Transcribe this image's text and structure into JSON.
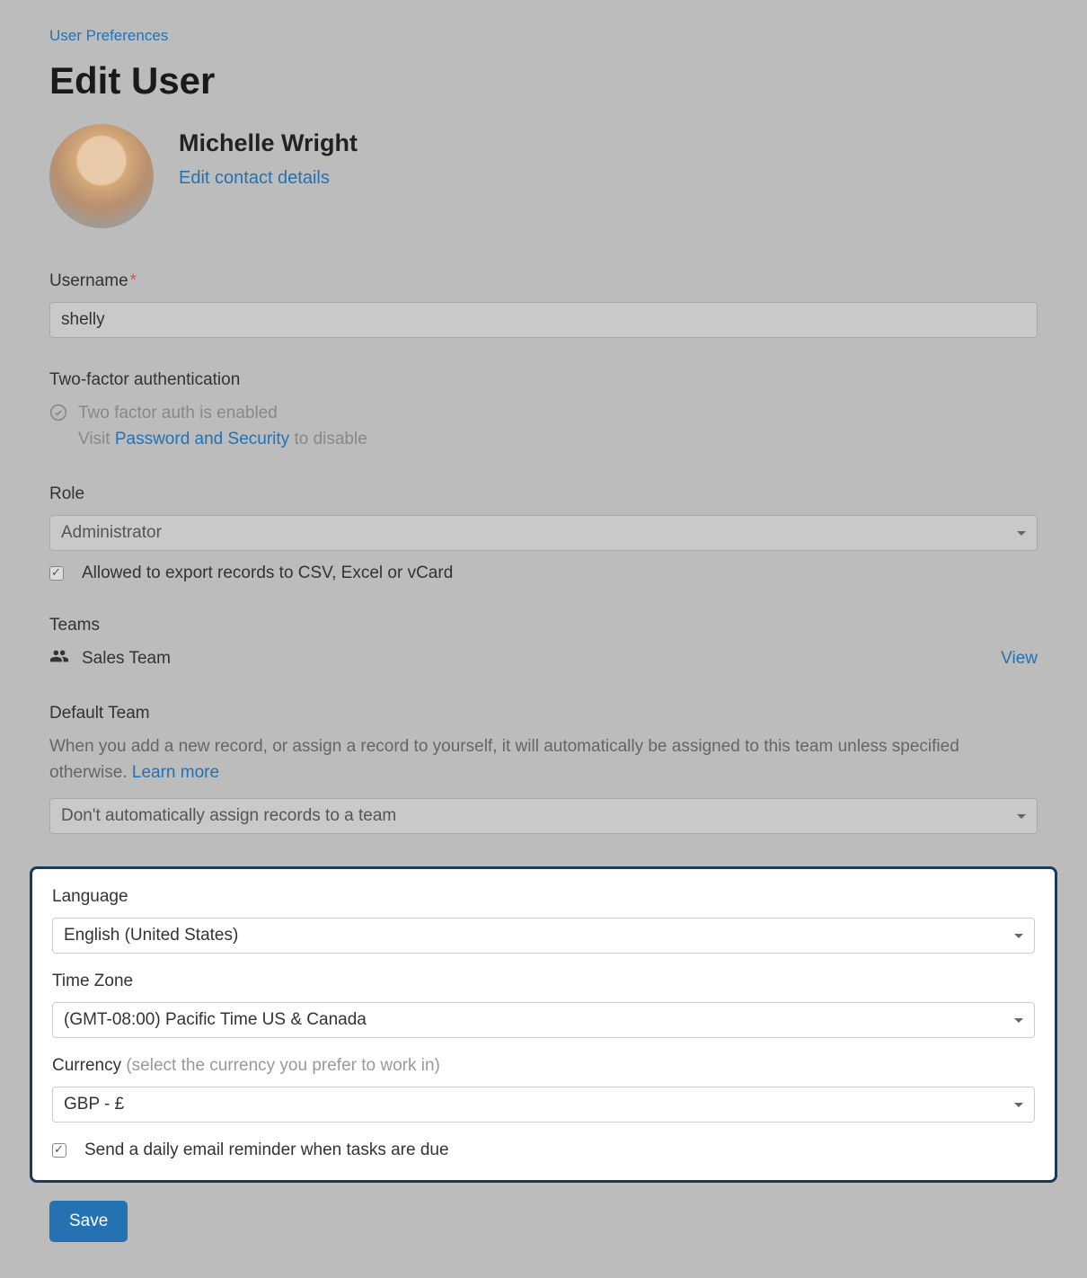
{
  "breadcrumb": "User Preferences",
  "page_title": "Edit User",
  "user": {
    "name": "Michelle Wright",
    "edit_contact_label": "Edit contact details"
  },
  "username": {
    "label": "Username",
    "required_marker": "*",
    "value": "shelly"
  },
  "tfa": {
    "label": "Two-factor authentication",
    "status": "Two factor auth is enabled",
    "visit_prefix": "Visit ",
    "link_text": "Password and Security",
    "visit_suffix": " to disable"
  },
  "role": {
    "label": "Role",
    "value": "Administrator"
  },
  "export_checkbox": {
    "label": "Allowed to export records to CSV, Excel or vCard",
    "checked": true
  },
  "teams": {
    "label": "Teams",
    "team_name": "Sales Team",
    "view_label": "View"
  },
  "default_team": {
    "label": "Default Team",
    "help": "When you add a new record, or assign a record to yourself, it will automatically be assigned to this team unless specified otherwise. ",
    "learn_more": "Learn more",
    "value": "Don't automatically assign records to a team"
  },
  "language": {
    "label": "Language",
    "value": "English (United States)"
  },
  "timezone": {
    "label": "Time Zone",
    "value": "(GMT-08:00) Pacific Time US & Canada"
  },
  "currency": {
    "label": "Currency ",
    "hint": "(select the currency you prefer to work in)",
    "value": "GBP - £"
  },
  "reminder_checkbox": {
    "label": "Send a daily email reminder when tasks are due",
    "checked": true
  },
  "save_button": "Save"
}
